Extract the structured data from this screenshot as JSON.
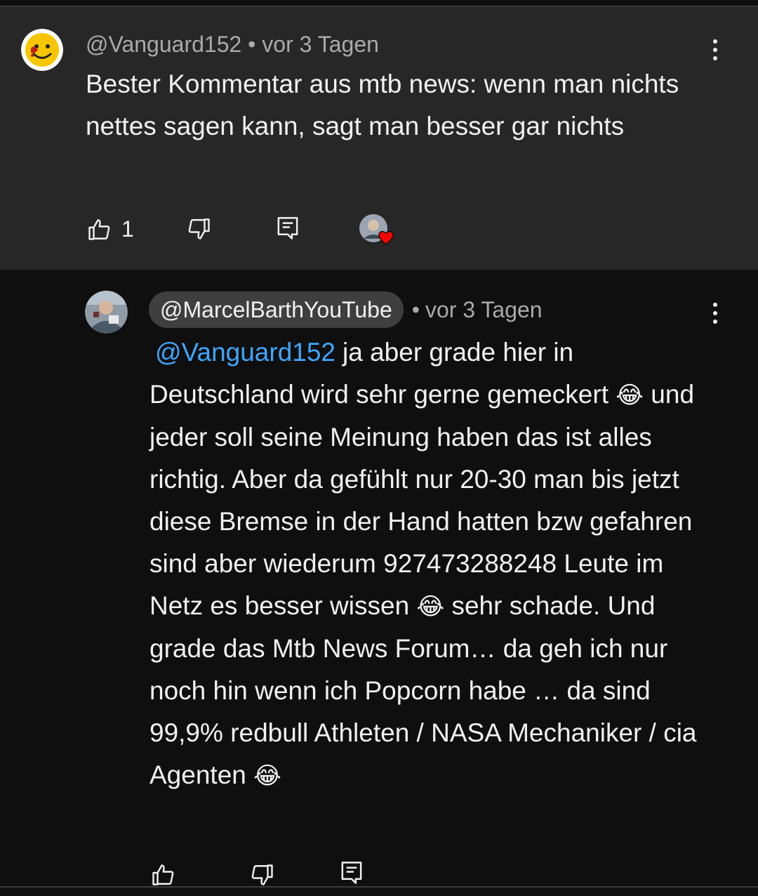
{
  "parent_comment": {
    "author": "@Vanguard152",
    "separator": "•",
    "time": "vor 3 Tagen",
    "text": "Bester Kommentar aus mtb news: wenn man nichts nettes sagen kann, sagt man besser gar nichts",
    "like_count": "1",
    "icons": {
      "avatar": "smiley-avatar-icon",
      "like": "thumb-up-icon",
      "dislike": "thumb-down-icon",
      "reply": "reply-icon",
      "creator_heart": "creator-heart-icon",
      "menu": "more-vert-icon"
    }
  },
  "reply_comment": {
    "author": "@MarcelBarthYouTube",
    "separator": "•",
    "time": "vor 3 Tagen",
    "mention": "@Vanguard152",
    "text_parts": [
      "ja aber grade hier in Deutschland wird sehr gerne gemeckert",
      "😂",
      "und jeder soll seine Meinung haben das ist alles richtig. Aber da gefühlt nur 20-30 man bis jetzt diese Bremse in der Hand hatten bzw gefahren sind aber wiederum 927473288248 Leute im Netz es besser wissen",
      "😂",
      "sehr schade. Und grade das Mtb News Forum… da geh ich nur noch hin wenn ich Popcorn habe … da sind 99,9% redbull Athleten / NASA Mechaniker / cia Agenten",
      "😂"
    ]
  },
  "colors": {
    "background": "#0f0f0f",
    "parent_background": "#272727",
    "text": "#f1f1f1",
    "meta": "#aaaaaa",
    "mention": "#3ea6ff",
    "author_chip": "#3f3f3f",
    "heart": "#ff0000"
  }
}
